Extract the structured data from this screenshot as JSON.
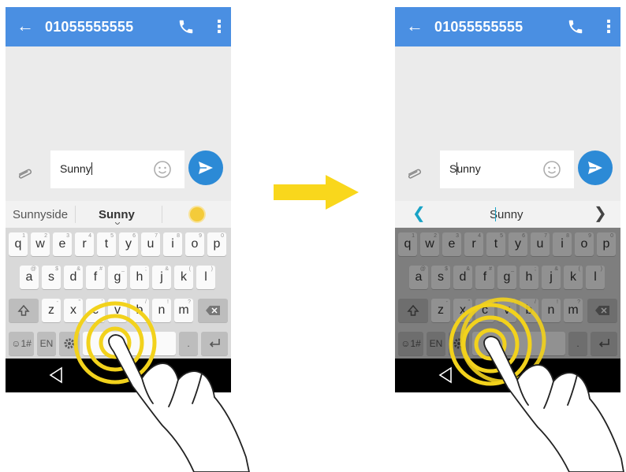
{
  "phones": [
    {
      "phone_number": "01055555555",
      "message_text": "Sunny",
      "suggestions": [
        "Sunnyside",
        "Sunny"
      ],
      "suggestion_emoji": "sun-emoji"
    },
    {
      "phone_number": "01055555555",
      "message_text": "Sunny",
      "suggestion_center": "Sunny",
      "nav_left_icon": "chevron-left-icon",
      "nav_right_icon": "chevron-right-icon"
    }
  ],
  "keyboard": {
    "row1": [
      {
        "k": "q",
        "h": "1"
      },
      {
        "k": "w",
        "h": "2"
      },
      {
        "k": "e",
        "h": "3"
      },
      {
        "k": "r",
        "h": "4"
      },
      {
        "k": "t",
        "h": "5"
      },
      {
        "k": "y",
        "h": "6"
      },
      {
        "k": "u",
        "h": "7"
      },
      {
        "k": "i",
        "h": "8"
      },
      {
        "k": "o",
        "h": "9"
      },
      {
        "k": "p",
        "h": "0"
      }
    ],
    "row2": [
      {
        "k": "a",
        "h": "@"
      },
      {
        "k": "s",
        "h": "$"
      },
      {
        "k": "d",
        "h": "&"
      },
      {
        "k": "f",
        "h": "#"
      },
      {
        "k": "g",
        "h": "_"
      },
      {
        "k": "h",
        "h": ";"
      },
      {
        "k": "j",
        "h": "&"
      },
      {
        "k": "k",
        "h": "("
      },
      {
        "k": "l",
        "h": ")"
      }
    ],
    "row3": [
      {
        "k": "z",
        "h": "-"
      },
      {
        "k": "x",
        "h": "\""
      },
      {
        "k": "c",
        "h": "'"
      },
      {
        "k": "v",
        "h": ":"
      },
      {
        "k": "b",
        "h": "/"
      },
      {
        "k": "n",
        "h": "!"
      },
      {
        "k": "m",
        "h": "?"
      }
    ],
    "emoji_key": "☺1#",
    "lang_key": "EN",
    "period_key": "."
  },
  "colors": {
    "appbar": "#4a8fe2",
    "send": "#2c8ad6",
    "arrow": "#f9d71c",
    "gesture_rings": "#f2d21c",
    "cursor": "#19a3c6"
  }
}
